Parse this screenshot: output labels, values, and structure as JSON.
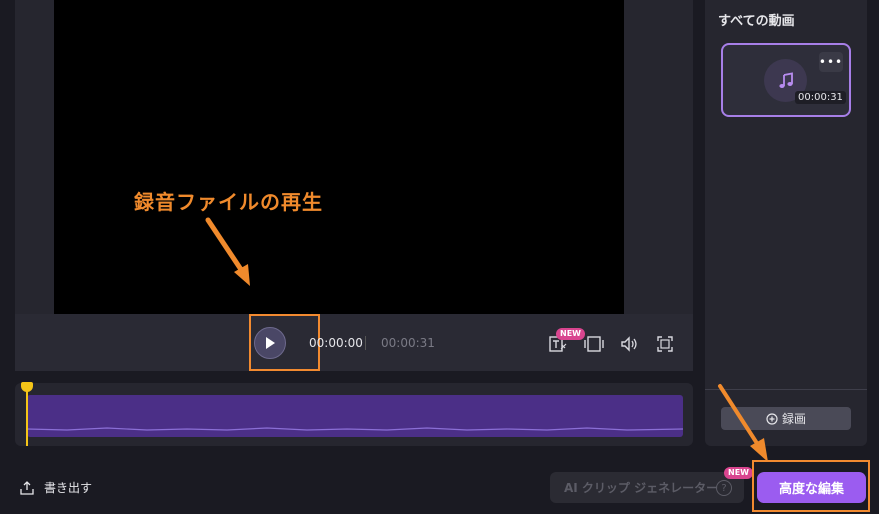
{
  "player": {
    "current_time": "00:00:00",
    "total_time": "00:00:31",
    "badge_new": "NEW"
  },
  "annotation": {
    "text": "録音ファイルの再生"
  },
  "sidebar": {
    "title": "すべての動画",
    "clip_duration": "00:00:31",
    "more_label": "•••",
    "record_label": "録画"
  },
  "footer": {
    "export_label": "書き出す",
    "ai_clip_label": "AI クリップ ジェネレーター",
    "ai_badge": "NEW",
    "help_label": "?",
    "advanced_edit_label": "高度な編集"
  },
  "colors": {
    "accent": "#9b5cf0",
    "highlight": "#f28a30",
    "playhead": "#f5c518",
    "waveform": "#4b2f87",
    "badge": "#d9458f"
  },
  "icons": [
    "play-icon",
    "caption-icon",
    "aspect-ratio-icon",
    "volume-icon",
    "fullscreen-icon",
    "music-icon",
    "add-circle-icon",
    "export-icon",
    "help-icon"
  ]
}
